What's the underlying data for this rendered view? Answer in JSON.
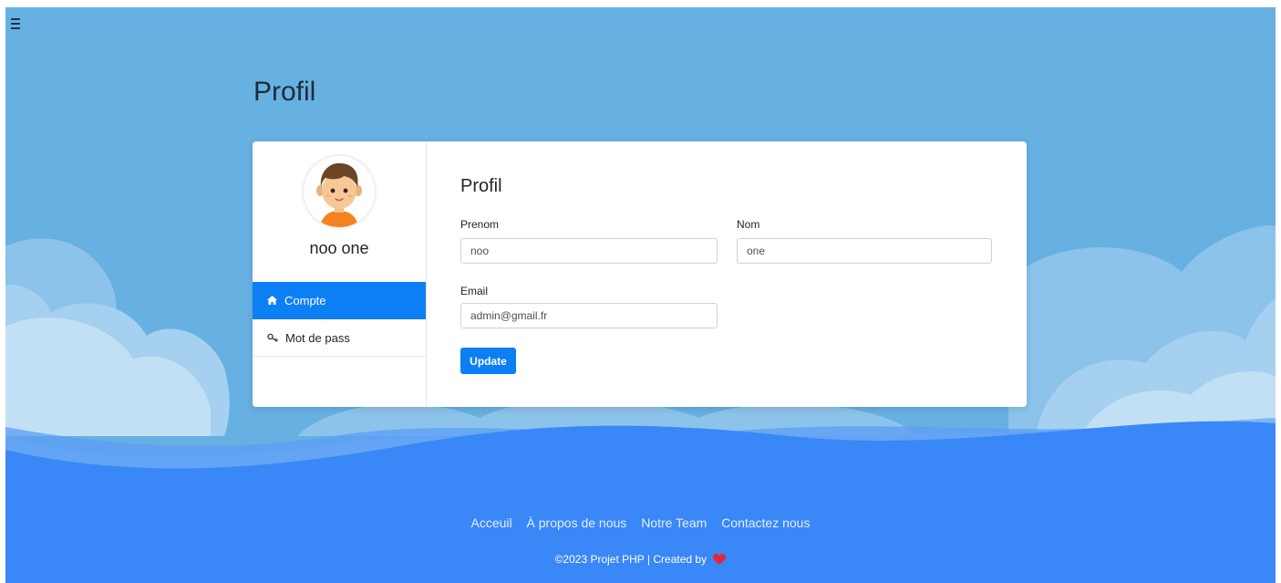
{
  "header": {
    "menu_icon": "hamburger-icon",
    "page_title": "Profil"
  },
  "profile": {
    "avatar_icon": "boy-avatar-icon",
    "name": "noo one",
    "nav": [
      {
        "label": "Compte",
        "icon": "home-icon",
        "active": true
      },
      {
        "label": "Mot de pass",
        "icon": "key-icon",
        "active": false
      }
    ]
  },
  "form": {
    "title": "Profil",
    "prenom_label": "Prenom",
    "prenom_value": "noo",
    "nom_label": "Nom",
    "nom_value": "one",
    "email_label": "Email",
    "email_value": "admin@gmail.fr",
    "update_label": "Update"
  },
  "footer": {
    "links": [
      "Acceuil",
      "À propos de nous",
      "Notre Team",
      "Contactez nous"
    ],
    "copyright": "©2023 Projet PHP | Created by",
    "heart_icon": "heart-icon"
  },
  "colors": {
    "sky": "#67b0e2",
    "sea": "#3a87f7",
    "accent": "#0d7ff4",
    "heart": "#e3263a"
  }
}
